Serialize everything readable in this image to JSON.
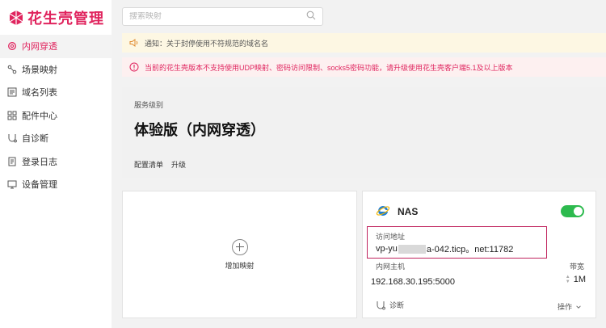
{
  "app": {
    "title": "花生壳管理",
    "brand_color": "#e0245e"
  },
  "sidebar": {
    "items": [
      {
        "label": "内网穿透",
        "icon": "gear-icon",
        "active": true
      },
      {
        "label": "场景映射",
        "icon": "scene-icon",
        "active": false
      },
      {
        "label": "域名列表",
        "icon": "list-icon",
        "active": false
      },
      {
        "label": "配件中心",
        "icon": "grid-icon",
        "active": false
      },
      {
        "label": "自诊断",
        "icon": "diagnose-icon",
        "active": false
      },
      {
        "label": "登录日志",
        "icon": "log-icon",
        "active": false
      },
      {
        "label": "设备管理",
        "icon": "device-icon",
        "active": false
      }
    ]
  },
  "search": {
    "placeholder": "搜索映射",
    "value": ""
  },
  "notices": {
    "info": "通知：关于封停使用不符规范的域名名",
    "warning": "当前的花生壳版本不支持使用UDP映射、密码访问限制、socks5密码功能，请升级使用花生壳客户端5.1及以上版本"
  },
  "service": {
    "label": "服务级别",
    "title": "体验版（内网穿透）",
    "links": [
      "配置清单",
      "升级"
    ]
  },
  "add_card": {
    "label": "增加映射"
  },
  "mapping": {
    "name": "NAS",
    "enabled": true,
    "address_label": "访问地址",
    "address_prefix": "vp-yu",
    "address_suffix": "a-042.ticp。net:11782",
    "host_label": "内网主机",
    "host_value": "192.168.30.195:5000",
    "bandwidth_label": "带宽",
    "bandwidth_value": "1M",
    "diagnose_label": "诊断",
    "ops_label": "操作"
  }
}
